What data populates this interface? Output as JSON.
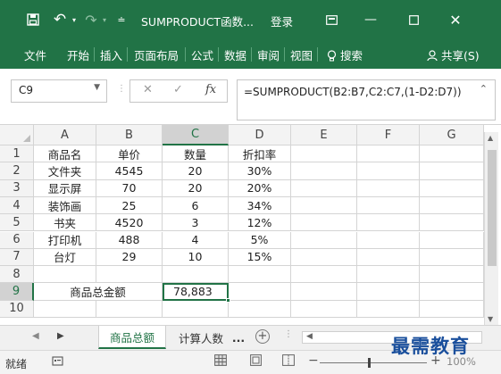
{
  "titlebar": {
    "title": "SUMPRODUCT函数...",
    "login": "登录",
    "save_icon": "save-icon",
    "undo_icon": "undo-icon",
    "redo_icon": "redo-icon"
  },
  "ribbon": {
    "tabs": [
      "文件",
      "开始",
      "插入",
      "页面布局",
      "公式",
      "数据",
      "审阅",
      "视图"
    ],
    "search": "搜索",
    "share": "共享(S)"
  },
  "formula_bar": {
    "name_box": "C9",
    "fx_label": "fx",
    "formula": "=SUMPRODUCT(B2:B7,C2:C7,(1-D2:D7))"
  },
  "grid": {
    "columns": [
      "A",
      "B",
      "C",
      "D",
      "E",
      "F",
      "G"
    ],
    "rows": [
      "1",
      "2",
      "3",
      "4",
      "5",
      "6",
      "7",
      "8",
      "9",
      "10"
    ],
    "header_row": [
      "商品名",
      "单价",
      "数量",
      "折扣率"
    ],
    "data_rows": [
      [
        "文件夹",
        "4545",
        "20",
        "30%"
      ],
      [
        "显示屏",
        "70",
        "20",
        "20%"
      ],
      [
        "装饰画",
        "25",
        "6",
        "34%"
      ],
      [
        "书夹",
        "4520",
        "3",
        "12%"
      ],
      [
        "打印机",
        "488",
        "4",
        "5%"
      ],
      [
        "台灯",
        "29",
        "10",
        "15%"
      ]
    ],
    "total_label": "商品总金额",
    "total_value": "78,883",
    "active_cell": "C9"
  },
  "sheets": {
    "tabs": [
      "商品总额",
      "计算人数"
    ],
    "active": "商品总额",
    "more": "...",
    "add": "+"
  },
  "statusbar": {
    "status": "就绪",
    "zoom": "100%"
  },
  "watermark": "最需教育",
  "colors": {
    "accent": "#217346",
    "watermark": "#1a4f9c"
  }
}
